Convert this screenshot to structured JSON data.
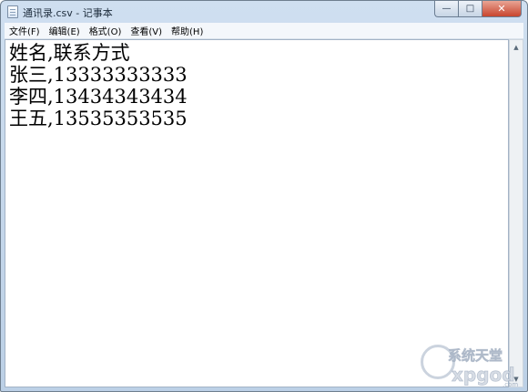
{
  "window": {
    "title": "通讯录.csv - 记事本",
    "min_glyph": "—",
    "max_glyph": "□",
    "close_glyph": "✕"
  },
  "menu": [
    "文件(F)",
    "编辑(E)",
    "格式(O)",
    "查看(V)",
    "帮助(H)"
  ],
  "content": {
    "lines": [
      "姓名,联系方式",
      "张三,13333333333",
      "李四,13434343434",
      "王五,13535353535"
    ]
  },
  "watermark": {
    "top": "系统天堂",
    "bottom": "xpgod",
    "suffix": ".com"
  },
  "scrollbar": {
    "up": "▲",
    "down": "▼"
  },
  "colors": {
    "titlebar": "#cfdff0",
    "close_button": "#c8452e",
    "editor_bg": "#ffffff"
  },
  "icons": [
    "notepad-icon",
    "minimize-icon",
    "maximize-icon",
    "close-icon",
    "logo-icon"
  ]
}
